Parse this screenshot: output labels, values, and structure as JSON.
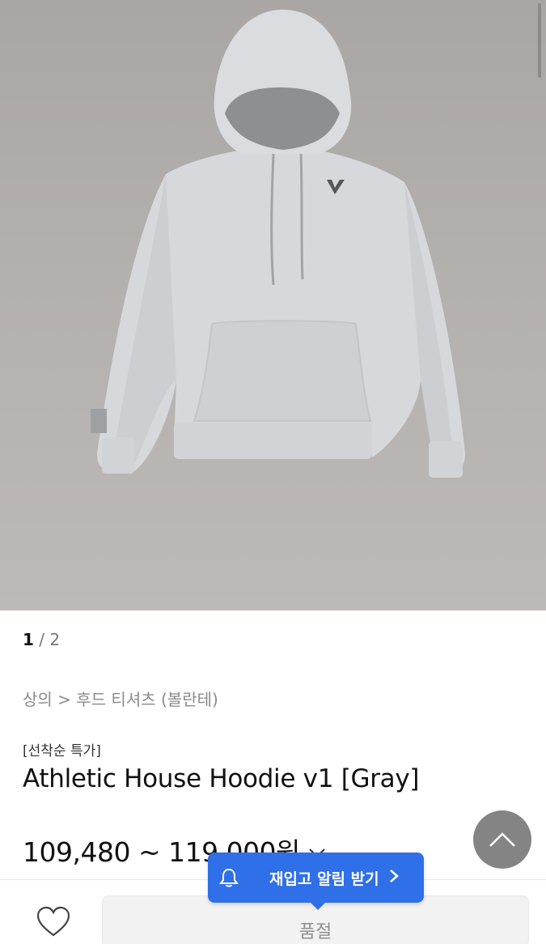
{
  "gallery": {
    "current": "1",
    "separator": " / ",
    "total": "2"
  },
  "breadcrumb": "상의 > 후드 티셔츠 (볼란테)",
  "product": {
    "tag": "[선착순 특가]",
    "title": "Athletic House Hoodie v1 [Gray]",
    "price": "109,480 ~ 119,000원"
  },
  "restock": {
    "label": "재입고 알림 받기"
  },
  "actions": {
    "soldout_label": "품절"
  },
  "icons": {
    "chevron": "chevron-down-icon",
    "scroll_top": "chevron-up-icon",
    "wishlist": "heart-icon",
    "bell": "bell-icon",
    "restock_arrow": "chevron-right-icon"
  },
  "colors": {
    "accent": "#2f6fe8",
    "hero_bg": "#b0adaa",
    "soldout_bg": "#f2f2f2"
  }
}
